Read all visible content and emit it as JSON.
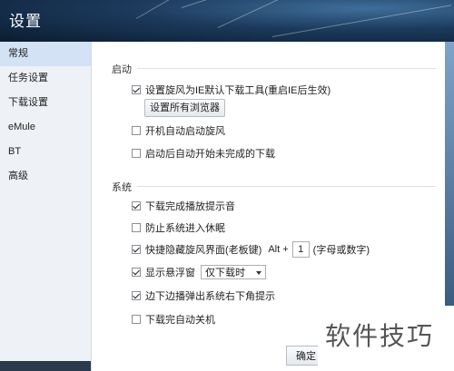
{
  "window": {
    "title": "设置"
  },
  "sidebar": {
    "items": [
      {
        "label": "常规",
        "active": true
      },
      {
        "label": "任务设置"
      },
      {
        "label": "下载设置"
      },
      {
        "label": "eMule"
      },
      {
        "label": "BT"
      },
      {
        "label": "高级"
      }
    ]
  },
  "startup": {
    "label": "启动",
    "set_default": {
      "label": "设置旋风为IE默认下载工具(重启IE后生效)",
      "checked": true
    },
    "all_browsers_button": "设置所有浏览器",
    "auto_start": {
      "label": "开机自动启动旋风",
      "checked": false
    },
    "auto_resume": {
      "label": "启动后自动开始未完成的下载",
      "checked": false
    }
  },
  "system": {
    "label": "系统",
    "sound_on_complete": {
      "label": "下载完成播放提示音",
      "checked": true
    },
    "prevent_sleep": {
      "label": "防止系统进入休眠",
      "checked": false
    },
    "hotkey": {
      "label": "快捷隐藏旋风界面(老板键)",
      "checked": true,
      "modifier": "Alt +",
      "key": "1",
      "hint": "(字母或数字)"
    },
    "floating_window": {
      "label": "显示悬浮窗",
      "checked": true,
      "option": "仅下载时"
    },
    "edge_popup": {
      "label": "边下边播弹出系统右下角提示",
      "checked": true
    },
    "shutdown": {
      "label": "下载完自动关机",
      "checked": false
    }
  },
  "footer": {
    "ok_button": "确定"
  },
  "watermark": {
    "text": "软件技巧"
  },
  "colors": {
    "active_nav": "#d3e3f5",
    "sidebar_bg": "#eef1f5",
    "header": "#1c3a5c"
  }
}
